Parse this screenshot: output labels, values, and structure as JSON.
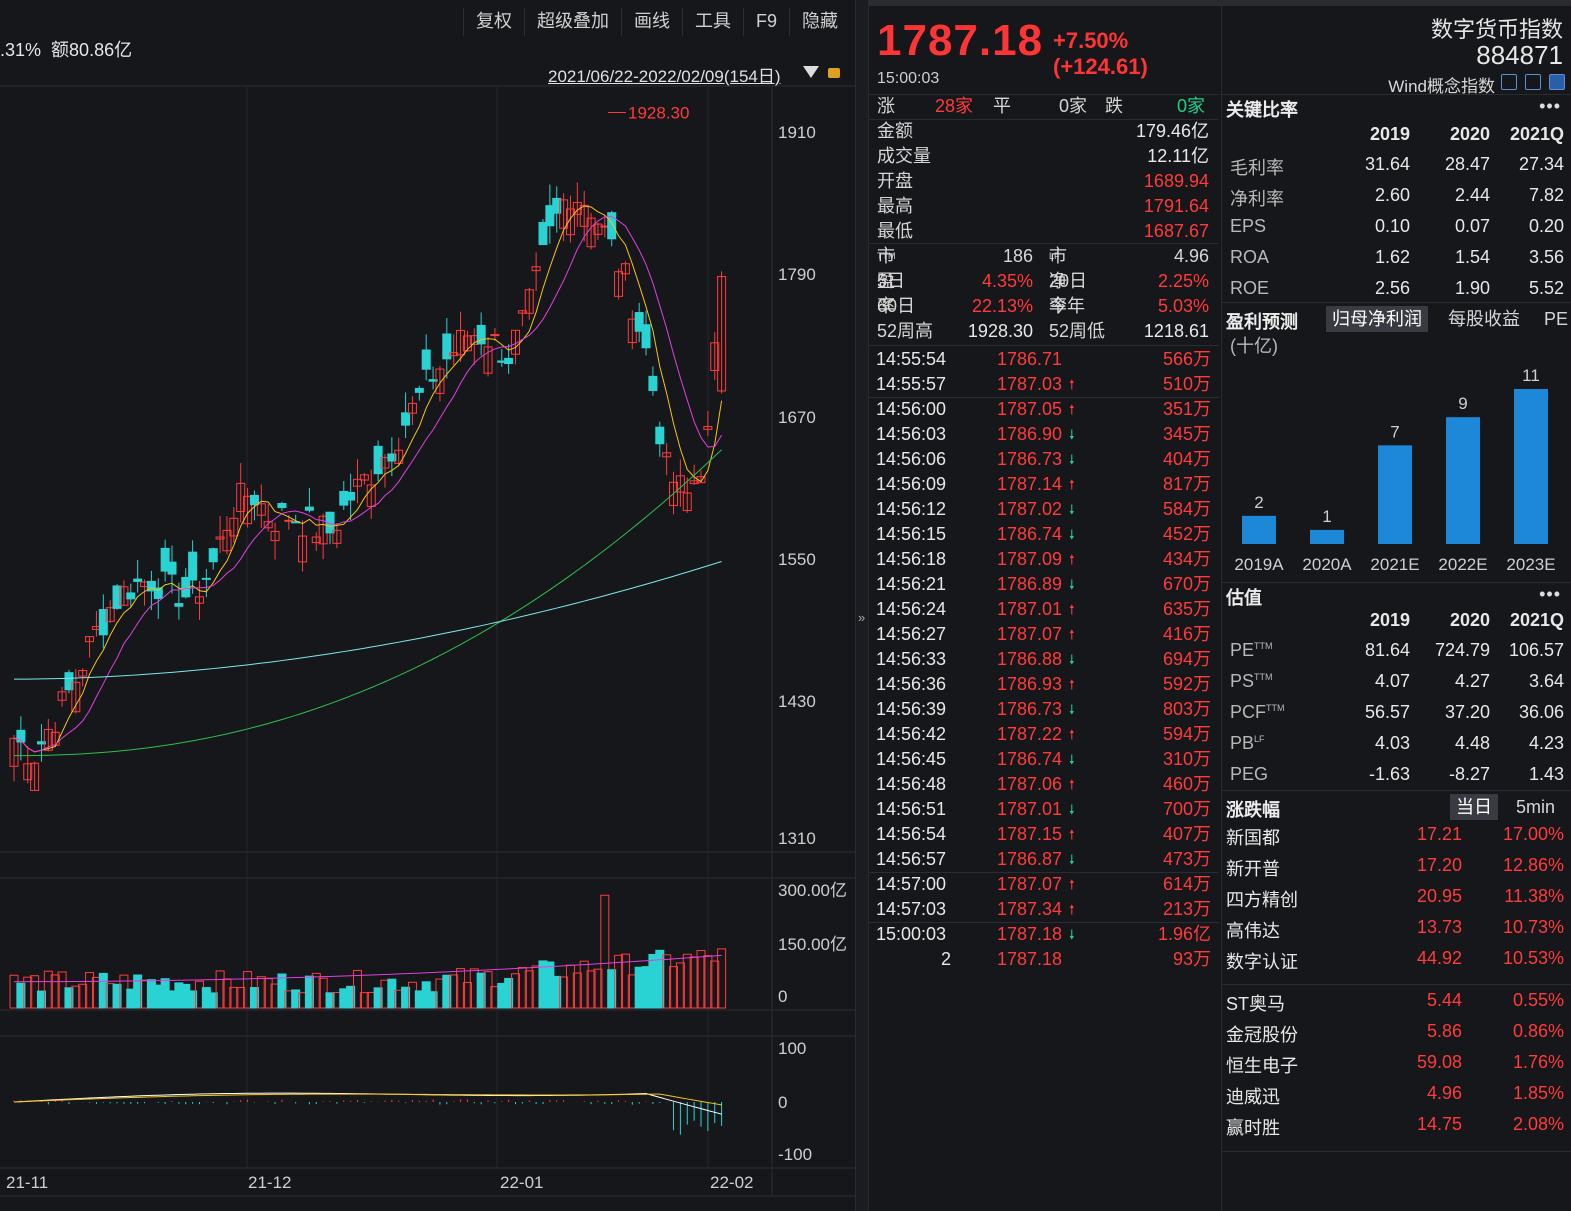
{
  "toolbar": {
    "items": [
      "复权",
      "超级叠加",
      "画线",
      "工具",
      "F9",
      "隐藏"
    ]
  },
  "statline": {
    "prefix": ".31%",
    "amount": "额80.86亿"
  },
  "range": {
    "label": "2021/06/22-2022/02/09(154日)"
  },
  "chart": {
    "price_axis": [
      "1910",
      "1790",
      "1670",
      "1550",
      "1430",
      "1310"
    ],
    "high_label": "1928.30",
    "volume_axis": [
      "300.00亿",
      "150.00亿",
      "0"
    ],
    "macd_axis": [
      "100",
      "0",
      "-100"
    ],
    "x_labels": [
      "21-11",
      "21-12",
      "22-01",
      "22-02"
    ]
  },
  "chart_data": {
    "type": "candlestick",
    "y_ticks": [
      1310,
      1430,
      1550,
      1670,
      1790,
      1910
    ],
    "max_marker": 1928.3,
    "x_ticks": [
      "21-11",
      "21-12",
      "22-01",
      "22-02"
    ],
    "last_bar": {
      "open": 1689.94,
      "high": 1791.64,
      "low": 1687.67,
      "close": 1787.18
    },
    "volume_ticks": [
      "0",
      "150.00亿",
      "300.00亿"
    ],
    "macd_ticks": [
      -100,
      0,
      100
    ]
  },
  "quote": {
    "price": "1787.18",
    "change": "+7.50% (+124.61)",
    "time": "15:00:03",
    "up_label": "涨",
    "up_count": "28家",
    "flat_label": "平",
    "flat_count": "0家",
    "down_label": "跌",
    "down_count": "0家",
    "fields": [
      {
        "label": "金额",
        "value": "179.46亿",
        "color": "white"
      },
      {
        "label": "成交量",
        "value": "12.11亿",
        "color": "white"
      },
      {
        "label": "开盘",
        "value": "1689.94",
        "color": "red"
      },
      {
        "label": "最高",
        "value": "1791.64",
        "color": "red"
      },
      {
        "label": "最低",
        "value": "1687.67",
        "color": "red"
      }
    ],
    "pe_label": "市盈率",
    "pe_sup": "TTM",
    "pe_value": "186",
    "pb_label": "市净率",
    "pb_sup": "LF",
    "pb_value": "4.96",
    "d5_label": "5日",
    "d5_value": "4.35%",
    "d20_label": "20日",
    "d20_value": "2.25%",
    "d60_label": "60日",
    "d60_value": "22.13%",
    "ytd_label": "今年",
    "ytd_value": "5.03%",
    "w52h_label": "52周高",
    "w52h_value": "1928.30",
    "w52l_label": "52周低",
    "w52l_value": "1218.61"
  },
  "ticks": [
    {
      "t": "14:55:54",
      "p": "1786.71",
      "a": "",
      "v": "566万"
    },
    {
      "t": "14:55:57",
      "p": "1787.03",
      "a": "up",
      "v": "510万"
    },
    {
      "t": "14:56:00",
      "p": "1787.05",
      "a": "up",
      "v": "351万"
    },
    {
      "t": "14:56:03",
      "p": "1786.90",
      "a": "down",
      "v": "345万"
    },
    {
      "t": "14:56:06",
      "p": "1786.73",
      "a": "down",
      "v": "404万"
    },
    {
      "t": "14:56:09",
      "p": "1787.14",
      "a": "up",
      "v": "817万"
    },
    {
      "t": "14:56:12",
      "p": "1787.02",
      "a": "down",
      "v": "584万"
    },
    {
      "t": "14:56:15",
      "p": "1786.74",
      "a": "down",
      "v": "452万"
    },
    {
      "t": "14:56:18",
      "p": "1787.09",
      "a": "up",
      "v": "434万"
    },
    {
      "t": "14:56:21",
      "p": "1786.89",
      "a": "down",
      "v": "670万"
    },
    {
      "t": "14:56:24",
      "p": "1787.01",
      "a": "up",
      "v": "635万"
    },
    {
      "t": "14:56:27",
      "p": "1787.07",
      "a": "up",
      "v": "416万"
    },
    {
      "t": "14:56:33",
      "p": "1786.88",
      "a": "down",
      "v": "694万"
    },
    {
      "t": "14:56:36",
      "p": "1786.93",
      "a": "up",
      "v": "592万"
    },
    {
      "t": "14:56:39",
      "p": "1786.73",
      "a": "down",
      "v": "803万"
    },
    {
      "t": "14:56:42",
      "p": "1787.22",
      "a": "up",
      "v": "594万"
    },
    {
      "t": "14:56:45",
      "p": "1786.74",
      "a": "down",
      "v": "310万"
    },
    {
      "t": "14:56:48",
      "p": "1787.06",
      "a": "up",
      "v": "460万"
    },
    {
      "t": "14:56:51",
      "p": "1787.01",
      "a": "down",
      "v": "700万"
    },
    {
      "t": "14:56:54",
      "p": "1787.15",
      "a": "up",
      "v": "407万"
    },
    {
      "t": "14:56:57",
      "p": "1786.87",
      "a": "down",
      "v": "473万"
    },
    {
      "t": "14:57:00",
      "p": "1787.07",
      "a": "up",
      "v": "614万"
    },
    {
      "t": "14:57:03",
      "p": "1787.34",
      "a": "up",
      "v": "213万"
    },
    {
      "t": "15:00:03",
      "p": "1787.18",
      "a": "down",
      "v": "1.96亿"
    },
    {
      "t": "2",
      "p": "1787.18",
      "a": "",
      "v": "93万"
    }
  ],
  "right": {
    "title": "数字货币指数",
    "code": "884871",
    "subtitle": "Wind概念指数",
    "key_ratio": {
      "title": "关键比率",
      "more": "•••",
      "headers": [
        "2019",
        "2020",
        "2021Q"
      ],
      "rows": [
        {
          "label": "毛利率",
          "vals": [
            "31.64",
            "28.47",
            "27.34"
          ]
        },
        {
          "label": "净利率",
          "vals": [
            "2.60",
            "2.44",
            "7.82"
          ]
        },
        {
          "label": "EPS",
          "vals": [
            "0.10",
            "0.07",
            "0.20"
          ]
        },
        {
          "label": "ROA",
          "vals": [
            "1.62",
            "1.54",
            "3.56"
          ]
        },
        {
          "label": "ROE",
          "vals": [
            "2.56",
            "1.90",
            "5.52"
          ]
        }
      ]
    },
    "forecast": {
      "title": "盈利预测",
      "tabs": [
        "归母净利润",
        "每股收益",
        "PE"
      ],
      "unit": "(十亿)",
      "bars": [
        {
          "label": "2019A",
          "value": 2
        },
        {
          "label": "2020A",
          "value": 1
        },
        {
          "label": "2021E",
          "value": 7
        },
        {
          "label": "2022E",
          "value": 9
        },
        {
          "label": "2023E",
          "value": 11
        }
      ]
    },
    "valuation": {
      "title": "估值",
      "more": "•••",
      "headers": [
        "2019",
        "2020",
        "2021Q"
      ],
      "rows": [
        {
          "label": "PE",
          "sup": "TTM",
          "vals": [
            "81.64",
            "724.79",
            "106.57"
          ]
        },
        {
          "label": "PS",
          "sup": "TTM",
          "vals": [
            "4.07",
            "4.27",
            "3.64"
          ]
        },
        {
          "label": "PCF",
          "sup": "TTM",
          "vals": [
            "56.57",
            "37.20",
            "36.06"
          ]
        },
        {
          "label": "PB",
          "sup": "LF",
          "vals": [
            "4.03",
            "4.48",
            "4.23"
          ]
        },
        {
          "label": "PEG",
          "sup": "",
          "vals": [
            "-1.63",
            "-8.27",
            "1.43"
          ]
        }
      ]
    },
    "movers": {
      "title": "涨跌幅",
      "tabs": [
        "当日",
        "5min"
      ],
      "top": [
        {
          "name": "新国都",
          "price": "17.21",
          "pct": "17.00%"
        },
        {
          "name": "新开普",
          "price": "17.20",
          "pct": "12.86%"
        },
        {
          "name": "四方精创",
          "price": "20.95",
          "pct": "11.38%"
        },
        {
          "name": "高伟达",
          "price": "13.73",
          "pct": "10.73%"
        },
        {
          "name": "数字认证",
          "price": "44.92",
          "pct": "10.53%"
        }
      ],
      "bottom": [
        {
          "name": "ST奥马",
          "price": "5.44",
          "pct": "0.55%"
        },
        {
          "name": "金冠股份",
          "price": "5.86",
          "pct": "0.86%"
        },
        {
          "name": "恒生电子",
          "price": "59.08",
          "pct": "1.76%"
        },
        {
          "name": "迪威迅",
          "price": "4.96",
          "pct": "1.85%"
        },
        {
          "name": "赢时胜",
          "price": "14.75",
          "pct": "2.08%"
        }
      ]
    }
  },
  "colors": {
    "up": "#ff3b3b",
    "down": "#2ad3d3",
    "bg": "#16171b",
    "ma5": "#ffffff",
    "ma10": "#f5c518",
    "ma20": "#e040e0",
    "ma60": "#2fbf4a",
    "ma120": "#7ee8e8",
    "bar_blue": "#1e88d8"
  }
}
